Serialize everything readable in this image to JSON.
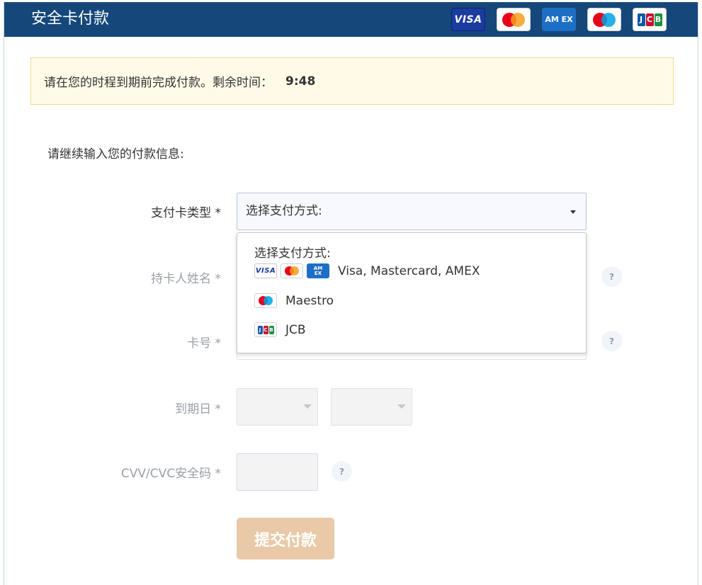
{
  "header": {
    "title": "安全卡付款",
    "card_logos": [
      {
        "name": "visa",
        "text": "VISA"
      },
      {
        "name": "mastercard"
      },
      {
        "name": "amex",
        "text": "AM EX"
      },
      {
        "name": "maestro"
      },
      {
        "name": "jcb",
        "text": "JCB"
      }
    ]
  },
  "timer": {
    "message": "请在您的时程到期前完成付款。剩余时间：",
    "value": "9:48"
  },
  "intro": "请继续输入您的付款信息:",
  "form": {
    "card_type_label": "支付卡类型 *",
    "card_type_selected": "选择支付方式:",
    "cardholder_label": "持卡人姓名 *",
    "card_number_label": "卡号 *",
    "expiry_label": "到期日 *",
    "cvv_label": "CVV/CVC安全码 *",
    "help_symbol": "?",
    "submit_label": "提交付款"
  },
  "dropdown": {
    "header": "选择支付方式:",
    "options": [
      {
        "label": "Visa, Mastercard, AMEX",
        "icons": [
          "visa-icon",
          "mastercard-icon",
          "amex-icon"
        ]
      },
      {
        "label": "Maestro",
        "icons": [
          "maestro-icon"
        ]
      },
      {
        "label": "JCB",
        "icons": [
          "jcb-icon"
        ]
      }
    ]
  },
  "colors": {
    "header_bg": "#15477a",
    "notice_bg": "#fffbe8",
    "notice_border": "#f1dc8a",
    "submit_bg": "#e9c9a7",
    "visa_blue": "#1a3ba0",
    "amex_blue": "#1d6fc6",
    "mastercard_red": "#eb001b",
    "mastercard_orange": "#f79e1b",
    "maestro_red": "#e7001e",
    "maestro_blue": "#00a2e5",
    "jcb_blue": "#0d5aa7",
    "jcb_red": "#c8102e",
    "jcb_green": "#1a9142"
  }
}
